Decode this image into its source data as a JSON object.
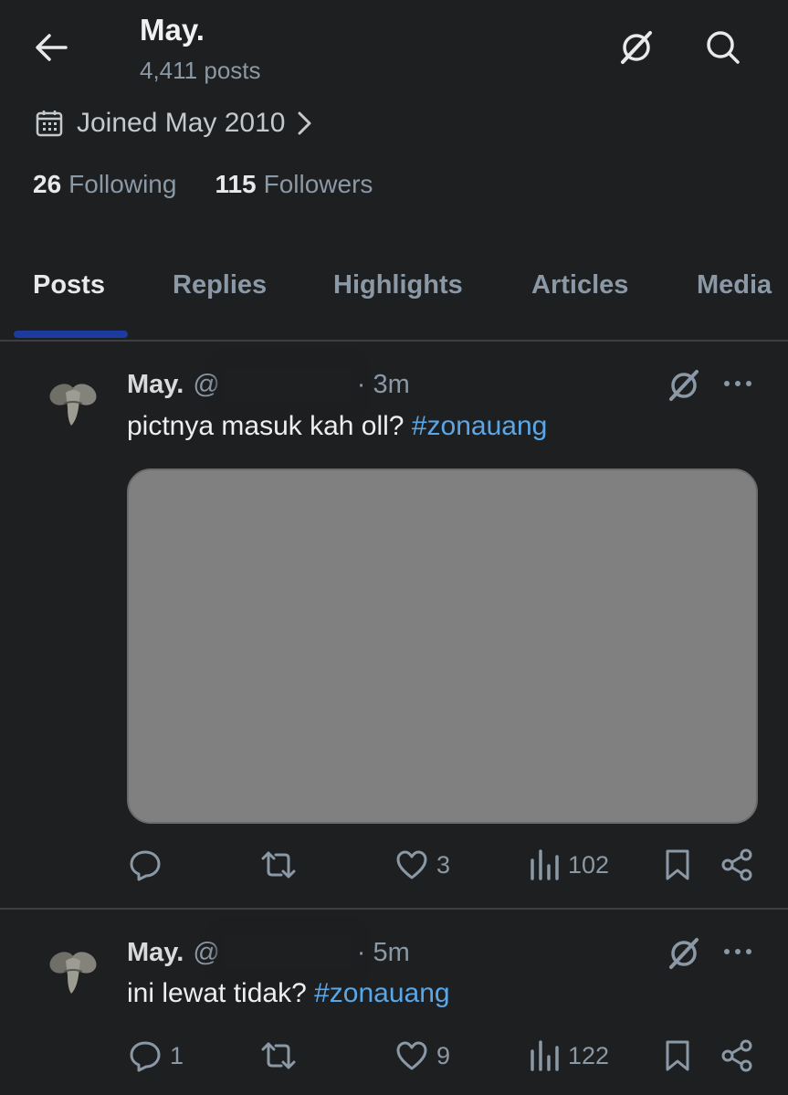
{
  "header": {
    "name": "May.",
    "posts_count": "4,411 posts"
  },
  "profile": {
    "joined": "Joined May 2010",
    "following_count": "26",
    "following_label": "Following",
    "followers_count": "115",
    "followers_label": "Followers"
  },
  "tabs": [
    {
      "label": "Posts",
      "active": true
    },
    {
      "label": "Replies",
      "active": false
    },
    {
      "label": "Highlights",
      "active": false
    },
    {
      "label": "Articles",
      "active": false
    },
    {
      "label": "Media",
      "active": false
    }
  ],
  "posts": [
    {
      "name": "May.",
      "handle_prefix": "@",
      "time": "· 3m",
      "text": "pictnya masuk kah oll?",
      "hashtag": "#zonauang",
      "has_media": true,
      "replies": "",
      "reposts": "",
      "likes": "3",
      "views": "102"
    },
    {
      "name": "May.",
      "handle_prefix": "@",
      "time": "· 5m",
      "text": "ini lewat tidak?",
      "hashtag": "#zonauang",
      "has_media": false,
      "replies": "1",
      "reposts": "",
      "likes": "9",
      "views": "122"
    }
  ],
  "icons": {
    "back": "back-arrow-icon",
    "grok": "grok-icon",
    "search": "search-icon",
    "calendar": "calendar-icon",
    "chevron": "chevron-right-icon",
    "more": "more-icon",
    "reply": "reply-icon",
    "repost": "repost-icon",
    "like": "heart-icon",
    "views": "views-icon",
    "bookmark": "bookmark-icon",
    "share": "share-icon"
  },
  "colors": {
    "background": "#1e1f21",
    "hashtag": "#5aa7e8",
    "tab_indicator": "#1d3a9e",
    "media_placeholder": "#808080"
  }
}
